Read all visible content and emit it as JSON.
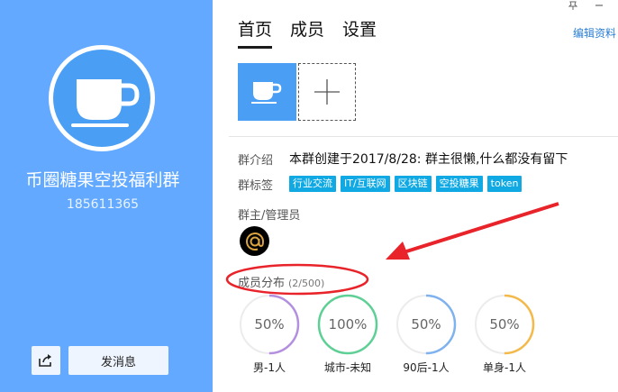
{
  "sidebar": {
    "group_name": "币圈糖果空投福利群",
    "group_id": "185611365",
    "share_icon": "share-icon",
    "send_message_label": "发消息"
  },
  "header": {
    "tabs": [
      {
        "label": "首页",
        "active": true
      },
      {
        "label": "成员",
        "active": false
      },
      {
        "label": "设置",
        "active": false
      }
    ],
    "edit_profile_label": "编辑资料",
    "pin_icon": "pin-icon",
    "minimize_icon": "minimize-icon",
    "close_icon": "close-icon"
  },
  "photos": {
    "main_icon": "coffee-cup-icon",
    "add_icon": "plus-icon"
  },
  "info": {
    "intro_label": "群介绍",
    "intro_text": "本群创建于2017/8/28:  群主很懒,什么都没有留下",
    "tags_label": "群标签",
    "tags": [
      "行业交流",
      "IT/互联网",
      "区块链",
      "空投糖果",
      "token"
    ],
    "admins_label": "群主/管理员",
    "admin_avatar_icon": "at-sign-avatar"
  },
  "distribution": {
    "title": "成员分布",
    "count": "(2/500)",
    "items": [
      {
        "value": "50%",
        "fraction": 0.5,
        "color": "#b38fe0",
        "label": "男-1人"
      },
      {
        "value": "100%",
        "fraction": 1.0,
        "color": "#5ecf95",
        "label": "城市-未知"
      },
      {
        "value": "50%",
        "fraction": 0.5,
        "color": "#7fb2ee",
        "label": "90后-1人"
      },
      {
        "value": "50%",
        "fraction": 0.5,
        "color": "#f3b94a",
        "label": "单身-1人"
      }
    ]
  },
  "colors": {
    "sidebar_bg": "#62a9ff",
    "accent": "#4a9ff5",
    "tag_bg": "#10a9e3",
    "annotation_red": "#e8232a"
  }
}
